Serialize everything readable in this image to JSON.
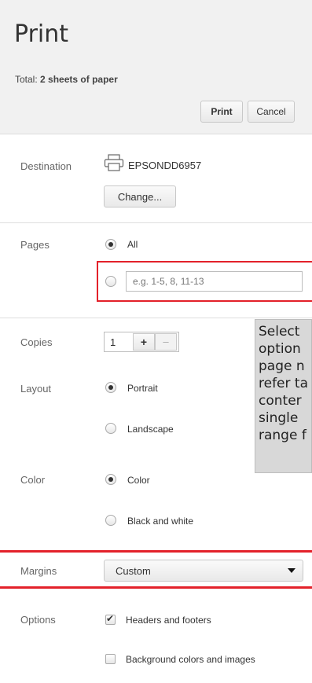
{
  "header": {
    "title": "Print",
    "total_label": "Total:",
    "total_value": "2 sheets",
    "total_suffix": "of paper",
    "print_button": "Print",
    "cancel_button": "Cancel"
  },
  "destination": {
    "label": "Destination",
    "printer_icon": "printer-icon",
    "printer_name": "EPSONDD6957",
    "change_button": "Change..."
  },
  "pages": {
    "label": "Pages",
    "all_label": "All",
    "range_placeholder": "e.g. 1-5, 8, 11-13",
    "selected": "All"
  },
  "copies": {
    "label": "Copies",
    "value": "1",
    "plus": "+",
    "minus": "–"
  },
  "layout": {
    "label": "Layout",
    "options": [
      "Portrait",
      "Landscape"
    ],
    "selected": "Portrait"
  },
  "color": {
    "label": "Color",
    "options": [
      "Color",
      "Black and white"
    ],
    "selected": "Color"
  },
  "margins": {
    "label": "Margins",
    "value": "Custom"
  },
  "options": {
    "label": "Options",
    "items": [
      {
        "label": "Headers and footers",
        "checked": true
      },
      {
        "label": "Background colors and images",
        "checked": false
      }
    ]
  },
  "tooltip": {
    "lines": [
      "Select",
      "option",
      "page n",
      "refer ta",
      "conter",
      "single",
      "range f"
    ]
  },
  "colors": {
    "highlight": "#e3212a",
    "header_bg": "#f1f1f1",
    "tooltip_bg": "#d8d8d8"
  }
}
